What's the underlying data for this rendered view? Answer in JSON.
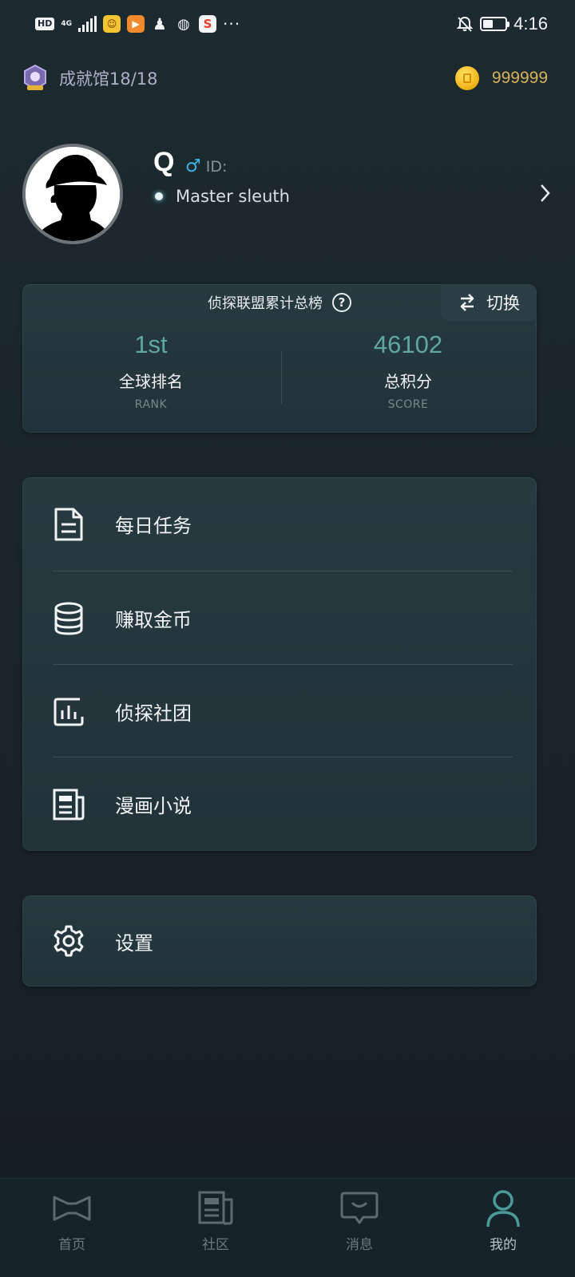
{
  "status_bar": {
    "network": "HD",
    "network_type": "4G",
    "time": "4:16",
    "app_icons": [
      "notification-app-1",
      "video-app",
      "qq",
      "browser",
      "weibo"
    ]
  },
  "header": {
    "achievement_label": "成就馆18/18",
    "coins": "999999"
  },
  "profile": {
    "username": "Q",
    "gender_symbol": "♂",
    "id_label": "ID:",
    "title": "Master sleuth"
  },
  "ranking": {
    "title": "侦探联盟累计总榜",
    "help_symbol": "?",
    "switch_label": "切换",
    "rank_value": "1st",
    "rank_label": "全球排名",
    "rank_sublabel": "RANK",
    "score_value": "46102",
    "score_label": "总积分",
    "score_sublabel": "SCORE"
  },
  "menu": {
    "items": [
      {
        "label": "每日任务",
        "icon": "document-icon"
      },
      {
        "label": "赚取金币",
        "icon": "coin-stack-icon"
      },
      {
        "label": "侦探社团",
        "icon": "bar-chart-icon"
      },
      {
        "label": "漫画小说",
        "icon": "newspaper-icon"
      }
    ]
  },
  "settings": {
    "label": "设置",
    "icon": "gear-icon"
  },
  "bottom_nav": {
    "items": [
      {
        "label": "首页",
        "icon": "home-bowtie-icon"
      },
      {
        "label": "社区",
        "icon": "community-icon"
      },
      {
        "label": "消息",
        "icon": "message-icon"
      },
      {
        "label": "我的",
        "icon": "profile-icon"
      }
    ],
    "active_index": 3
  },
  "colors": {
    "accent_value": "#5fa8a0",
    "coin_text": "#d6b25a",
    "achievement_text": "#aeb0c8",
    "gender": "#3db3e8",
    "nav_active": "#4a9a98"
  }
}
